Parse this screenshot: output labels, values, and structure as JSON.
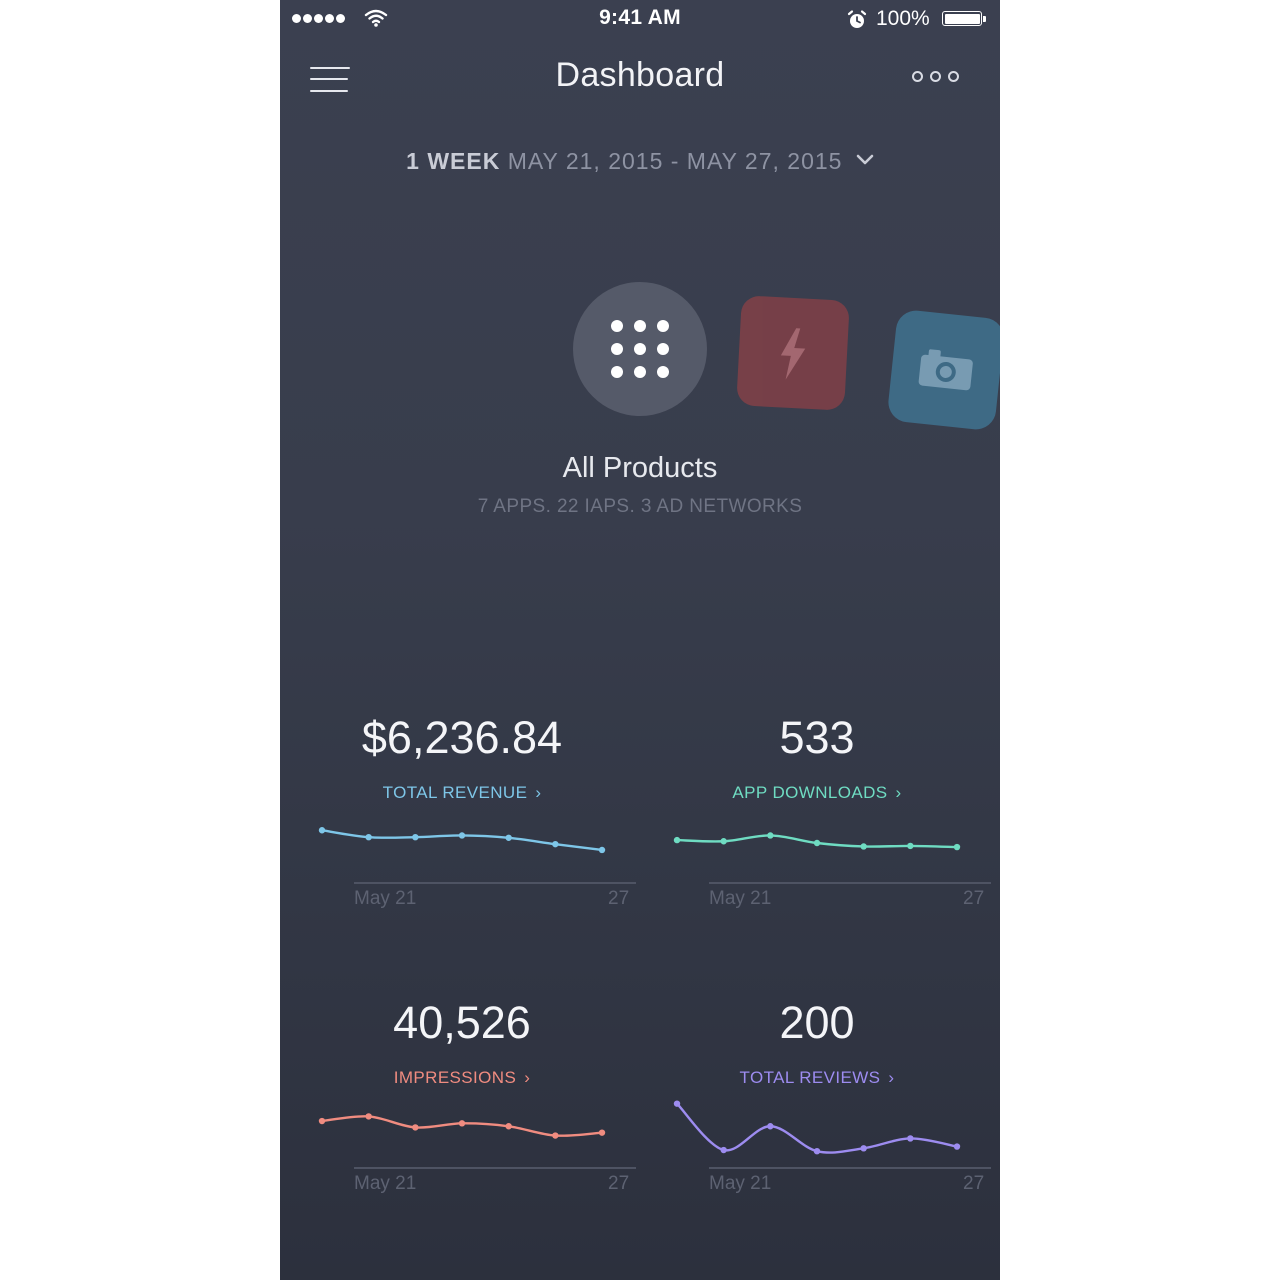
{
  "status_bar": {
    "time": "9:41 AM",
    "battery": "100%"
  },
  "nav": {
    "title": "Dashboard"
  },
  "range": {
    "period": "1 WEEK",
    "dates": "MAY 21, 2015 - MAY 27, 2015"
  },
  "products": {
    "title": "All Products",
    "subtitle": "7 APPS. 22 IAPS. 3 AD NETWORKS",
    "icons": [
      "grid-icon",
      "lightning-icon",
      "camera-icon"
    ]
  },
  "colors": {
    "revenue": "#7ec6e8",
    "downloads": "#6fdcc2",
    "impressions": "#f08c80",
    "reviews": "#9d8cf0"
  },
  "cards": [
    {
      "value": "$6,236.84",
      "label": "TOTAL REVENUE",
      "axis_start": "May 21",
      "axis_end": "27",
      "color": "#7ec6e8",
      "trend": [
        0.72,
        0.6,
        0.6,
        0.63,
        0.59,
        0.48,
        0.38
      ]
    },
    {
      "value": "533",
      "label": "APP DOWNLOADS",
      "axis_start": "May 21",
      "axis_end": "27",
      "color": "#6fdcc2",
      "trend": [
        0.55,
        0.53,
        0.63,
        0.5,
        0.44,
        0.45,
        0.43
      ]
    },
    {
      "value": "40,526",
      "label": "IMPRESSIONS",
      "axis_start": "May 21",
      "axis_end": "27",
      "color": "#f08c80",
      "trend": [
        0.62,
        0.7,
        0.51,
        0.58,
        0.53,
        0.37,
        0.42
      ]
    },
    {
      "value": "200",
      "label": "TOTAL REVIEWS",
      "axis_start": "May 21",
      "axis_end": "27",
      "color": "#9d8cf0",
      "trend": [
        0.92,
        0.12,
        0.53,
        0.1,
        0.15,
        0.32,
        0.18
      ]
    }
  ]
}
